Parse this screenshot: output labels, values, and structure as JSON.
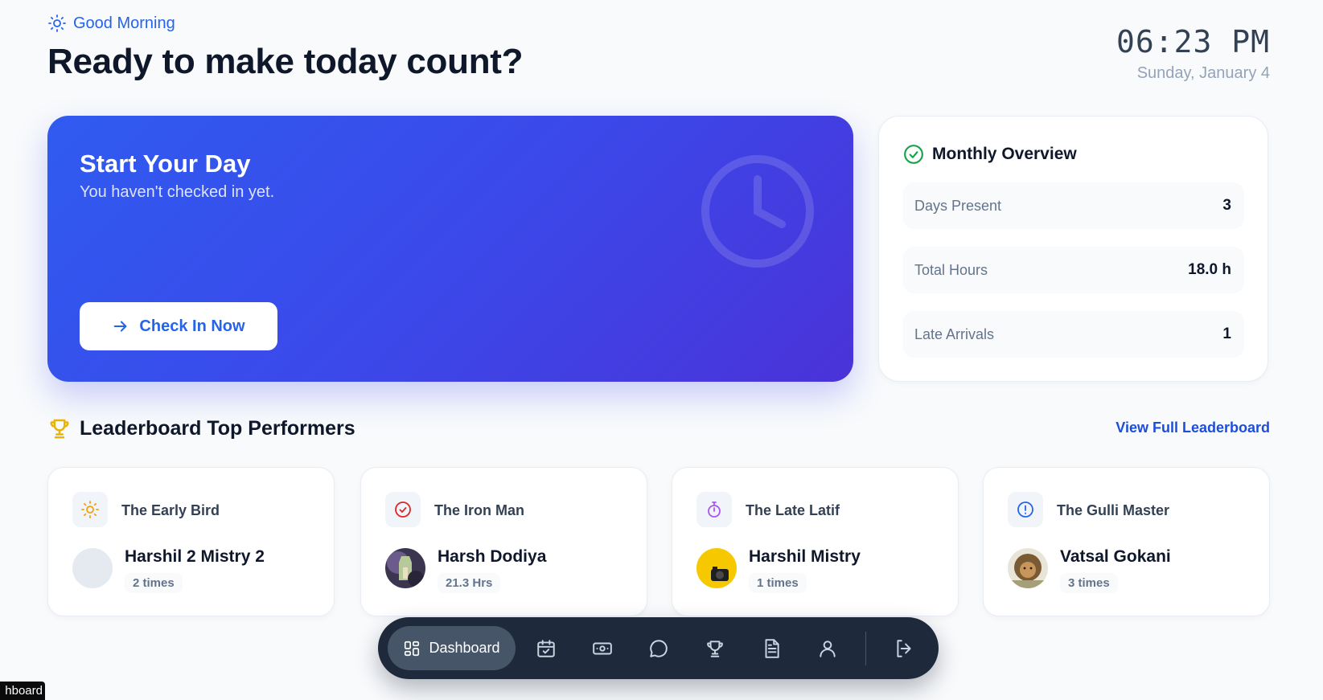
{
  "header": {
    "greeting": "Good Morning",
    "headline": "Ready to make today count?",
    "time": "06:23 PM",
    "date": "Sunday, January 4"
  },
  "hero": {
    "title": "Start Your Day",
    "subtitle": "You haven't checked in yet.",
    "button_label": "Check In Now"
  },
  "overview": {
    "title": "Monthly Overview",
    "rows": [
      {
        "label": "Days Present",
        "value": "3"
      },
      {
        "label": "Total Hours",
        "value": "18.0 h"
      },
      {
        "label": "Late Arrivals",
        "value": "1"
      }
    ]
  },
  "leaderboard": {
    "title": "Leaderboard Top Performers",
    "link_label": "View Full Leaderboard",
    "cards": [
      {
        "award": "The Early Bird",
        "name": "Harshil 2 Mistry 2",
        "stat": "2 times",
        "icon": "sun-icon",
        "icon_color": "#f59e0b"
      },
      {
        "award": "The Iron Man",
        "name": "Harsh Dodiya",
        "stat": "21.3 Hrs",
        "icon": "check-circle-icon",
        "icon_color": "#dc2626"
      },
      {
        "award": "The Late Latif",
        "name": "Harshil Mistry",
        "stat": "1 times",
        "icon": "stopwatch-icon",
        "icon_color": "#a855f7"
      },
      {
        "award": "The Gulli Master",
        "name": "Vatsal Gokani",
        "stat": "3 times",
        "icon": "alert-circle-icon",
        "icon_color": "#2563eb"
      }
    ]
  },
  "dock": {
    "active_label": "Dashboard",
    "items": [
      "calendar-check-icon",
      "money-icon",
      "chat-icon",
      "trophy-icon",
      "document-icon",
      "user-icon",
      "logout-icon"
    ]
  },
  "tooltip": "hboard",
  "colors": {
    "accent": "#2563eb",
    "hero_start": "#2f5bf0",
    "hero_end": "#4a33d8",
    "dock_bg": "#1e293b",
    "trophy": "#eab308",
    "success": "#16a34a"
  }
}
